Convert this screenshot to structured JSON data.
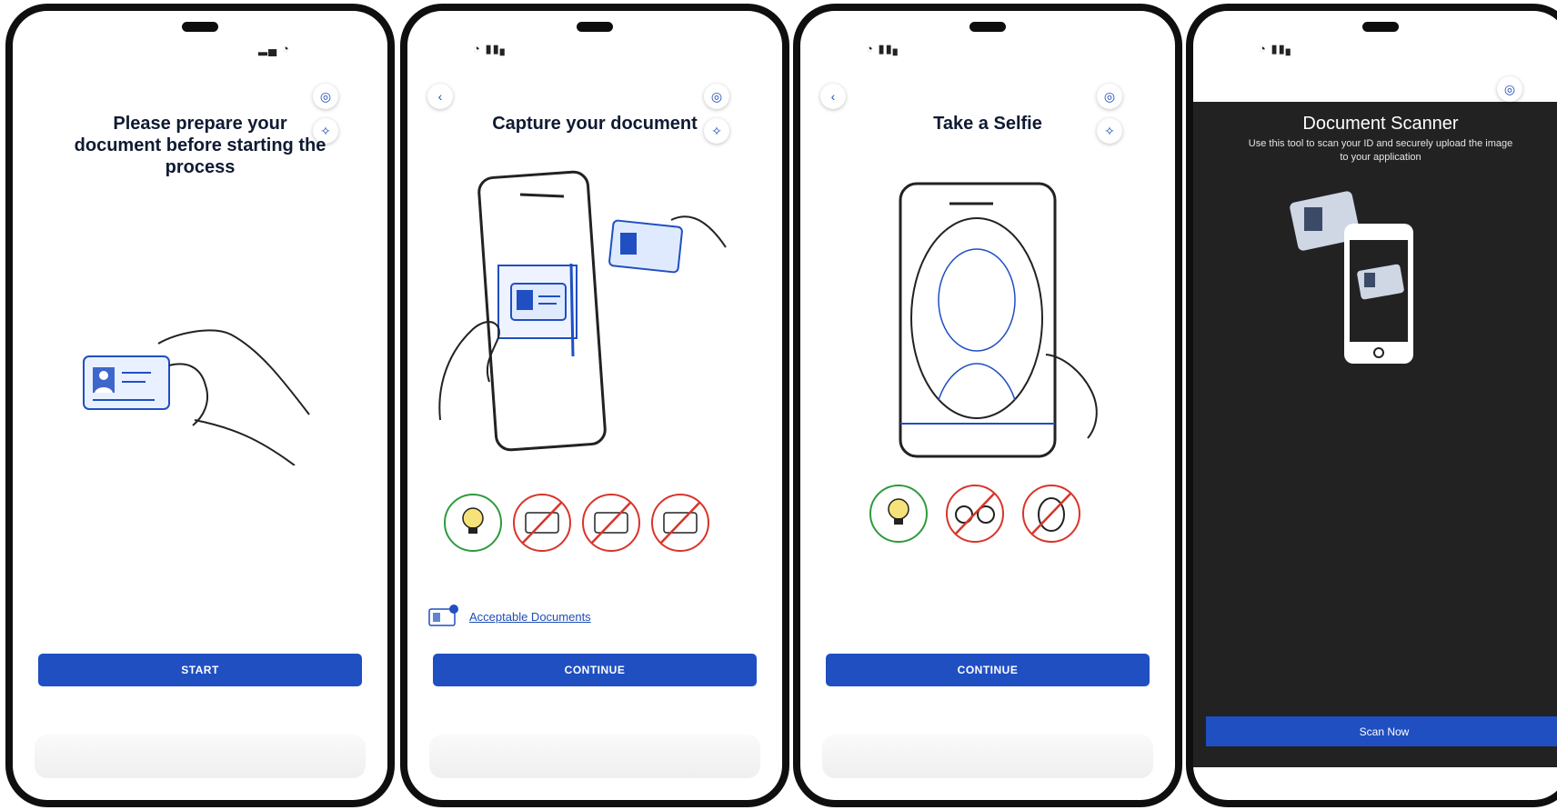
{
  "screens": [
    {
      "title": "Please prepare your document before starting the process",
      "cta": "START"
    },
    {
      "title": "Capture your document",
      "link": "Acceptable Documents",
      "cta": "CONTINUE"
    },
    {
      "title": "Take a Selfie",
      "cta": "CONTINUE"
    },
    {
      "title": "Document Scanner",
      "subtitle": "Use this tool to scan your ID and securely upload the image to your application",
      "cta": "Scan Now"
    }
  ],
  "icons": {
    "globe": "globe-icon",
    "accessibility": "accessibility-icon",
    "back": "chevron-left-icon"
  },
  "colors": {
    "accent": "#1f4fc1",
    "ok": "#2e9b3d",
    "no": "#d9342b",
    "dark_bg": "#222222"
  }
}
